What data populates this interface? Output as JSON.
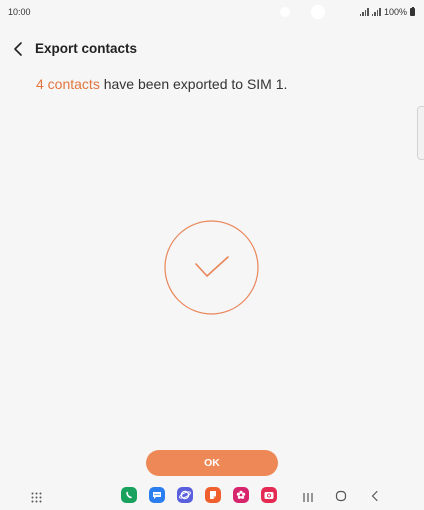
{
  "status_bar": {
    "time": "10:00",
    "battery": "100%"
  },
  "header": {
    "title": "Export contacts",
    "back_icon": "chevron-left-icon"
  },
  "message": {
    "link_text": "4 contacts",
    "rest_text": " have been exported to SIM 1."
  },
  "ok_button": {
    "label": "OK"
  },
  "colors": {
    "accent": "#e2753e",
    "button": "#ee8957",
    "background": "#f6f6f6"
  },
  "dock": {
    "apps": [
      {
        "name": "phone-app-icon",
        "color": "#19a25e"
      },
      {
        "name": "messages-app-icon",
        "color": "#2a7ef0"
      },
      {
        "name": "internet-app-icon",
        "color": "#5a5fde"
      },
      {
        "name": "notes-app-icon",
        "color": "#f0602f"
      },
      {
        "name": "gallery-app-icon",
        "color": "#d6246d"
      },
      {
        "name": "camera-app-icon",
        "color": "#e42a52"
      }
    ],
    "nav_icons": [
      "recent-apps-icon",
      "home-icon",
      "back-icon"
    ]
  }
}
